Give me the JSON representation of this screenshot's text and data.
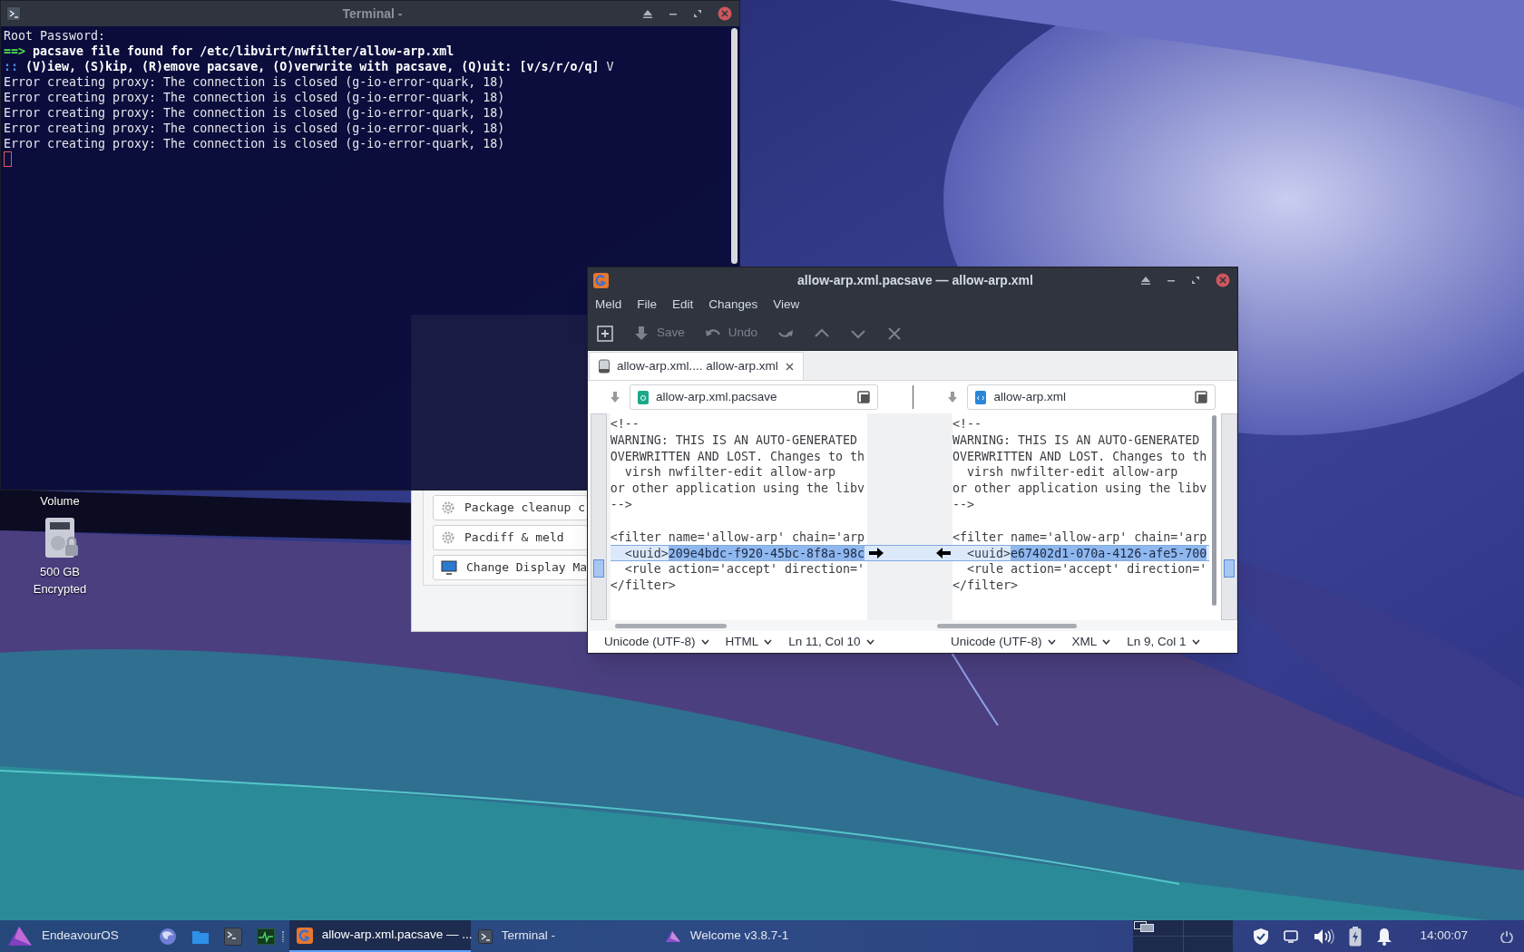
{
  "desktop_icons": [
    {
      "kind": "label-only",
      "label": "Volume"
    },
    {
      "kind": "locked-drive",
      "label": "500 GB Encrypted"
    }
  ],
  "welcome": {
    "buttons": [
      {
        "kind": "gear",
        "label": "Package cleanup c"
      },
      {
        "kind": "gear",
        "label": "Pacdiff & meld"
      },
      {
        "kind": "display",
        "label": "Change Display Ma"
      }
    ]
  },
  "terminal": {
    "title": "Terminal -",
    "lines": [
      {
        "kind": "plain",
        "text": "Root Password:"
      },
      {
        "kind": "arrow",
        "prompt": "==>",
        "text": "pacsave file found for /etc/libvirt/nwfilter/allow-arp.xml"
      },
      {
        "kind": "question",
        "prompt": "::",
        "text": "(V)iew, (S)kip, (R)emove pacsave, (O)verwrite with pacsave, (Q)uit: [v/s/r/o/q]",
        "answer": "V"
      },
      {
        "kind": "plain",
        "text": "Error creating proxy: The connection is closed (g-io-error-quark, 18)"
      },
      {
        "kind": "plain",
        "text": "Error creating proxy: The connection is closed (g-io-error-quark, 18)"
      },
      {
        "kind": "plain",
        "text": "Error creating proxy: The connection is closed (g-io-error-quark, 18)"
      },
      {
        "kind": "plain",
        "text": "Error creating proxy: The connection is closed (g-io-error-quark, 18)"
      },
      {
        "kind": "plain",
        "text": "Error creating proxy: The connection is closed (g-io-error-quark, 18)"
      },
      {
        "kind": "cursor"
      }
    ]
  },
  "meld": {
    "title": "allow-arp.xml.pacsave — allow-arp.xml",
    "menu": [
      "Meld",
      "File",
      "Edit",
      "Changes",
      "View"
    ],
    "toolbar": [
      {
        "kind": "new",
        "disabled": false
      },
      {
        "kind": "save",
        "label": "Save",
        "disabled": true
      },
      {
        "kind": "undo",
        "label": "Undo",
        "disabled": true
      },
      {
        "kind": "redo",
        "disabled": true
      },
      {
        "kind": "up",
        "disabled": true
      },
      {
        "kind": "down",
        "disabled": true
      },
      {
        "kind": "stop",
        "disabled": true
      }
    ],
    "tabs": [
      {
        "label": "allow-arp.xml.... allow-arp.xml",
        "selected": true
      }
    ],
    "panes": [
      {
        "file": {
          "name": "allow-arp.xml.pacsave",
          "kind": "archive"
        },
        "lines": [
          {
            "text": "<!--",
            "changed": false
          },
          {
            "text": "WARNING: THIS IS AN AUTO-GENERATED",
            "changed": false
          },
          {
            "text": "OVERWRITTEN AND LOST. Changes to th",
            "changed": false
          },
          {
            "text": "  virsh nwfilter-edit allow-arp",
            "changed": false
          },
          {
            "text": "or other application using the libv",
            "changed": false
          },
          {
            "text": "-->",
            "changed": false
          },
          {
            "changed": false
          },
          {
            "text": "<filter name='allow-arp' chain='arp",
            "changed": false
          },
          {
            "text": "  <uuid>",
            "selection": "209e4bdc-f920-45bc-8f8a-98c",
            "changed": true
          },
          {
            "text": "  <rule action='accept' direction='",
            "changed": false
          },
          {
            "text": "</filter>",
            "changed": false
          }
        ],
        "status": {
          "encoding": "Unicode (UTF-8)",
          "language": "HTML",
          "position": "Ln 11, Col 10"
        }
      },
      {
        "file": {
          "name": "allow-arp.xml",
          "kind": "code"
        },
        "lines": [
          {
            "text": "<!--",
            "changed": false
          },
          {
            "text": "WARNING: THIS IS AN AUTO-GENERATED",
            "changed": false
          },
          {
            "text": "OVERWRITTEN AND LOST. Changes to th",
            "changed": false
          },
          {
            "text": "  virsh nwfilter-edit allow-arp",
            "changed": false
          },
          {
            "text": "or other application using the libv",
            "changed": false
          },
          {
            "text": "-->",
            "changed": false
          },
          {
            "changed": false
          },
          {
            "text": "<filter name='allow-arp' chain='arp",
            "changed": false
          },
          {
            "text": "  <uuid>",
            "selection": "e67402d1-070a-4126-afe5-700",
            "changed": true
          },
          {
            "text": "  <rule action='accept' direction='",
            "changed": false
          },
          {
            "text": "</filter>",
            "changed": false
          }
        ],
        "status": {
          "encoding": "Unicode (UTF-8)",
          "language": "XML",
          "position": "Ln 9, Col 1"
        }
      }
    ]
  },
  "taskbar": {
    "start_label": "EndeavourOS",
    "launchers": [
      {
        "kind": "browser"
      },
      {
        "kind": "folder"
      },
      {
        "kind": "terminal"
      },
      {
        "kind": "monitor"
      }
    ],
    "tasks": [
      {
        "kind": "meld",
        "label": "allow-arp.xml.pacsave — ...",
        "selected": true
      },
      {
        "kind": "terminal",
        "label": "Terminal -",
        "selected": false
      },
      {
        "kind": "welcome",
        "label": "Welcome v3.8.7-1",
        "selected": false
      }
    ],
    "tray": [
      {
        "kind": "shield"
      },
      {
        "kind": "display"
      },
      {
        "kind": "volume"
      },
      {
        "kind": "battery"
      },
      {
        "kind": "bell"
      }
    ],
    "clock": "14:00:07"
  }
}
